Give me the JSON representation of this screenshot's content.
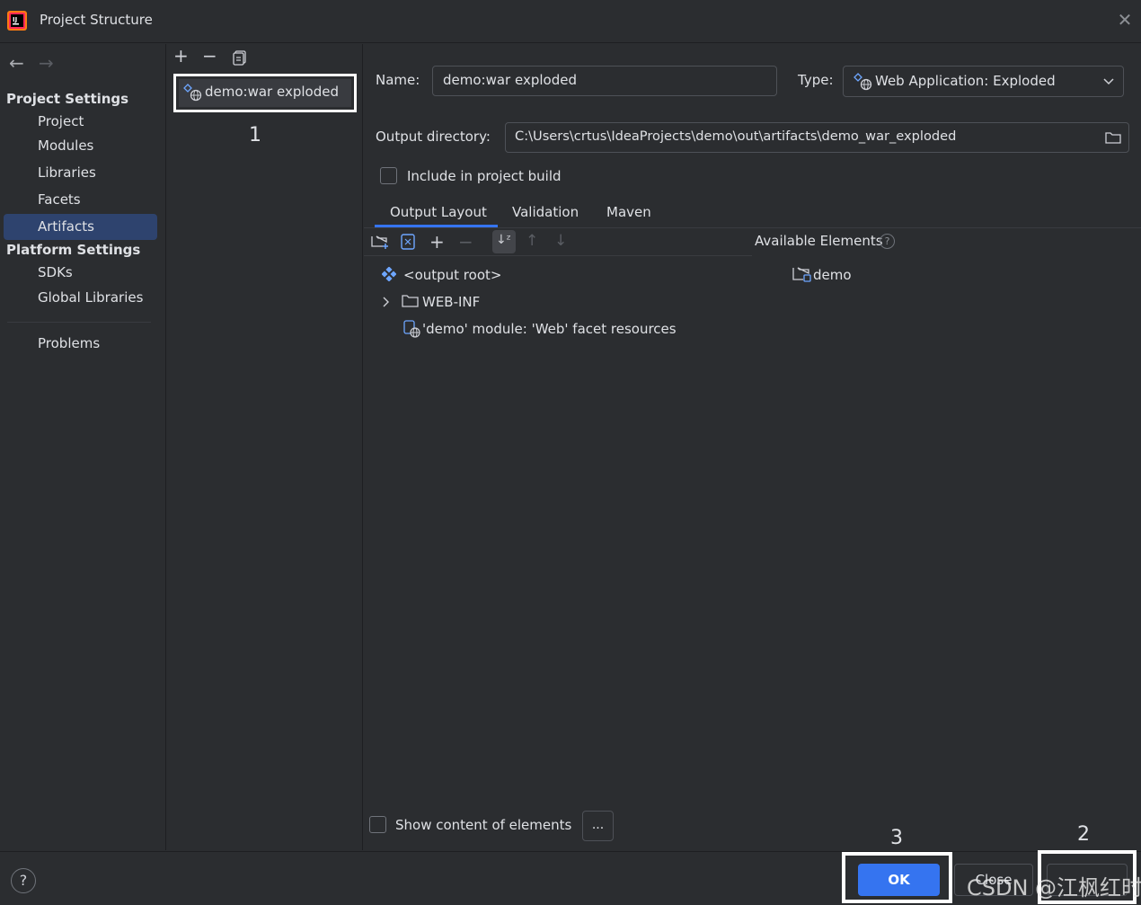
{
  "window": {
    "title": "Project Structure"
  },
  "sidebar": {
    "project_settings_label": "Project Settings",
    "project_items": [
      "Project",
      "Modules",
      "Libraries",
      "Facets",
      "Artifacts"
    ],
    "selected": "Artifacts",
    "platform_settings_label": "Platform Settings",
    "platform_items": [
      "SDKs",
      "Global Libraries"
    ],
    "problems_label": "Problems"
  },
  "artifacts_list": {
    "items": [
      "demo:war exploded"
    ],
    "annotation": "1"
  },
  "artifact": {
    "name_label": "Name:",
    "name_value": "demo:war exploded",
    "type_label": "Type:",
    "type_value": "Web Application: Exploded",
    "output_dir_label": "Output directory:",
    "output_dir_value": "C:\\Users\\crtus\\IdeaProjects\\demo\\out\\artifacts\\demo_war_exploded",
    "include_in_build_label": "Include in project build",
    "include_in_build_checked": false
  },
  "tabs": [
    "Output Layout",
    "Validation",
    "Maven"
  ],
  "active_tab": "Output Layout",
  "output_layout": {
    "tree": [
      "<output root>",
      "WEB-INF",
      "'demo' module: 'Web' facet resources"
    ],
    "available_elements_label": "Available Elements",
    "available_elements": [
      "demo"
    ],
    "show_content_label": "Show content of elements",
    "show_content_checked": false,
    "ellipsis_label": "..."
  },
  "footer": {
    "help_label": "?",
    "ok_label": "OK",
    "close_label": "Close",
    "annotation_ok": "3",
    "annotation_apply": "2",
    "watermark": "CSDN @江枫红时"
  },
  "colors": {
    "accent": "#3574f0",
    "background": "#2b2d30",
    "selection": "#2e436e"
  }
}
